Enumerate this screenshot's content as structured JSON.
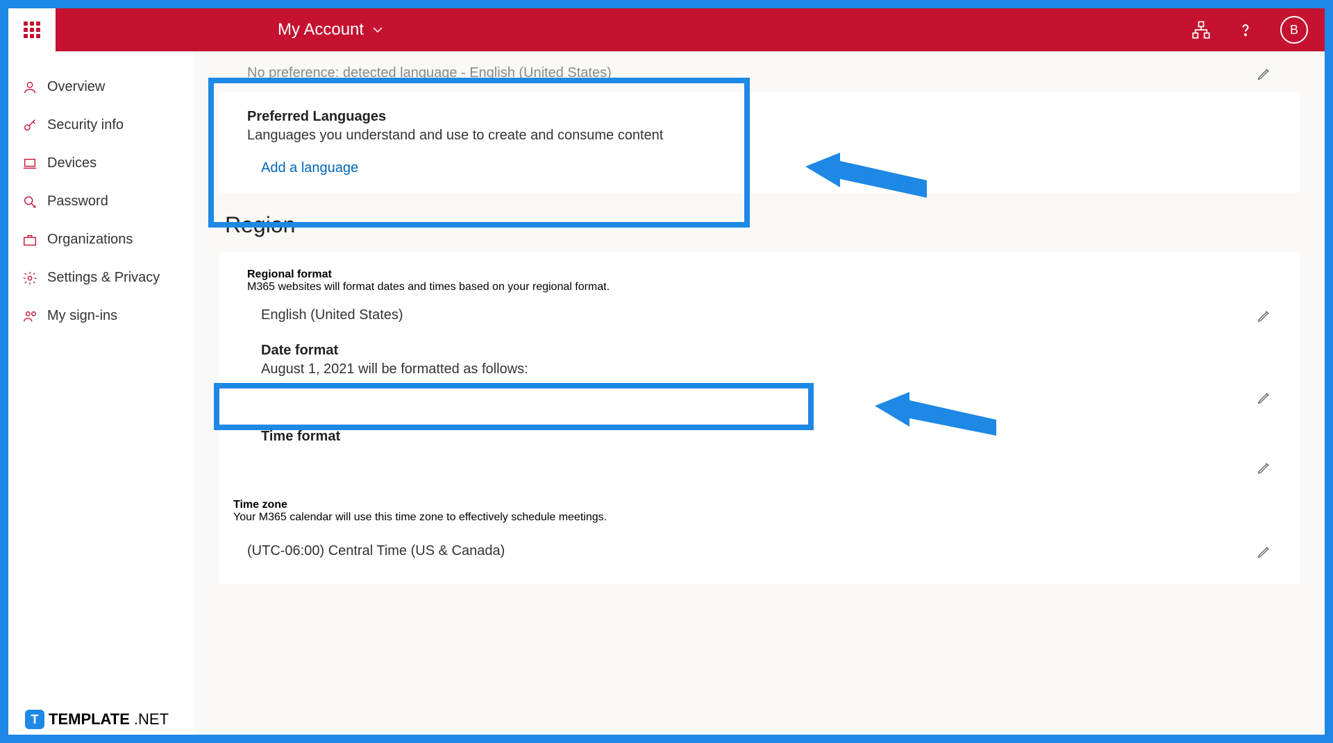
{
  "header": {
    "title": "My Account",
    "avatar_initial": "B"
  },
  "sidebar": {
    "items": [
      {
        "label": "Overview",
        "icon": "user"
      },
      {
        "label": "Security info",
        "icon": "key"
      },
      {
        "label": "Devices",
        "icon": "laptop"
      },
      {
        "label": "Password",
        "icon": "lock"
      },
      {
        "label": "Organizations",
        "icon": "briefcase"
      },
      {
        "label": "Settings & Privacy",
        "icon": "gear"
      },
      {
        "label": "My sign-ins",
        "icon": "signin"
      }
    ]
  },
  "language": {
    "detected": "No preference: detected language - English (United States)",
    "preferred_title": "Preferred Languages",
    "preferred_desc": "Languages you understand and use to create and consume content",
    "add_link": "Add a language"
  },
  "region": {
    "title": "Region",
    "format_title": "Regional format",
    "format_desc": "M365 websites will format dates and times based on your regional format.",
    "format_value": "English (United States)",
    "date_title": "Date format",
    "date_desc": "August 1, 2021 will be formatted as follows:",
    "time_title": "Time format",
    "tz_title": "Time zone",
    "tz_desc": "Your M365 calendar will use this time zone to effectively schedule meetings.",
    "tz_value": "(UTC-06:00) Central Time (US & Canada)"
  },
  "watermark": {
    "brand": "TEMPLATE",
    "suffix": ".NET"
  }
}
